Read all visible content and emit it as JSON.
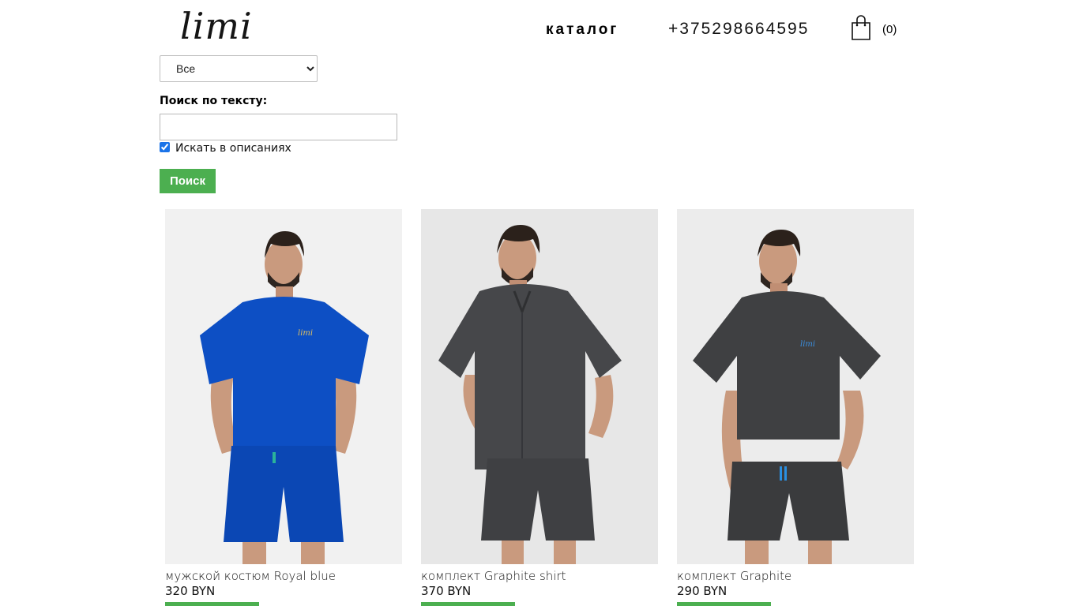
{
  "header": {
    "logo_text": "limi",
    "nav_catalog_label": "каталог",
    "phone": "+375298664595",
    "cart_count": "(0)"
  },
  "filters": {
    "category_selected": "Все",
    "search_label": "Поиск по тексту:",
    "search_value": "",
    "search_in_descriptions_label": "Искать в описаниях",
    "search_in_descriptions_checked": true,
    "search_button_label": "Поиск"
  },
  "products": [
    {
      "name": "мужской костюм Royal blue",
      "price": "320 BYN",
      "button_label": "",
      "outfit_color": "#0d4fc4",
      "logo_on_shirt": "limi"
    },
    {
      "name": "комплект Graphite shirt",
      "price": "370 BYN",
      "button_label": "",
      "outfit_color": "#46474a"
    },
    {
      "name": "комплект Graphite",
      "price": "290 BYN",
      "button_label": "",
      "outfit_color": "#3f4042",
      "logo_on_shirt": "limi"
    }
  ],
  "colors": {
    "accent_green": "#4caf50",
    "photo_background": "#eeeeee",
    "text": "#111111"
  }
}
